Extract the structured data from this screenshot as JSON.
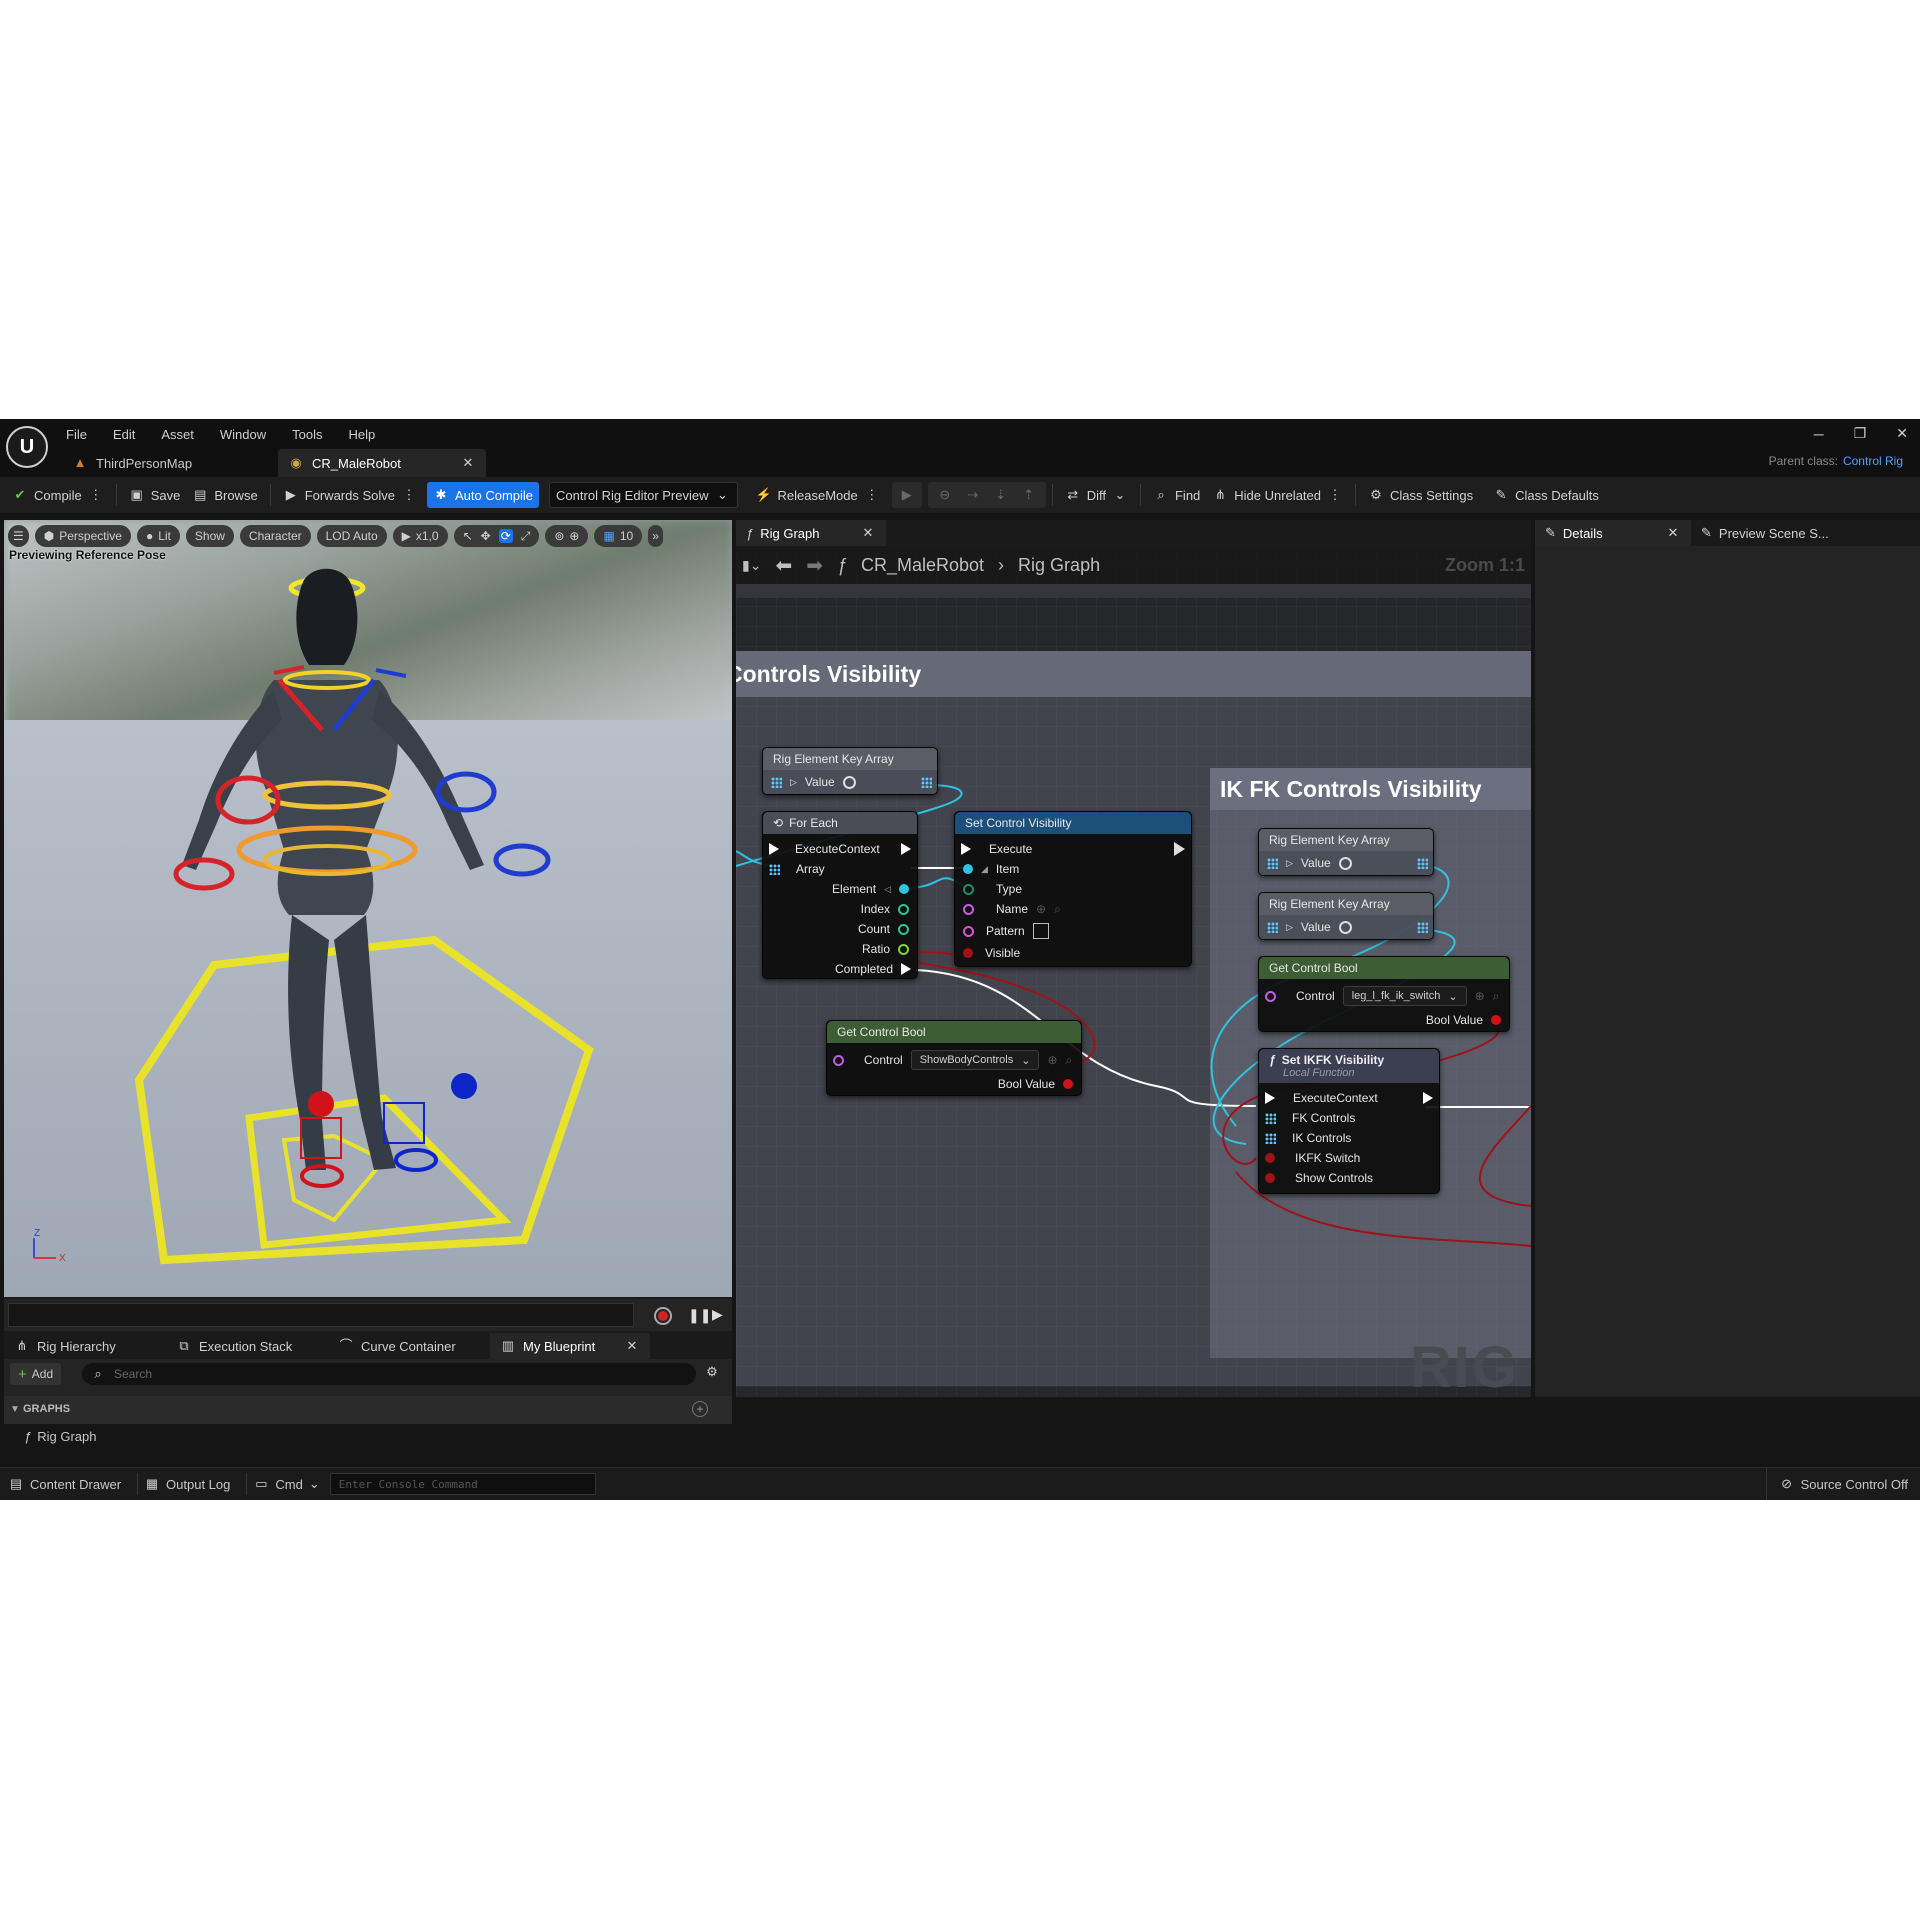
{
  "window": {
    "menu": [
      "File",
      "Edit",
      "Asset",
      "Window",
      "Tools",
      "Help"
    ],
    "tabs": [
      {
        "label": "ThirdPersonMap"
      },
      {
        "label": "CR_MaleRobot"
      }
    ],
    "parent_class_label": "Parent class:",
    "parent_class_value": "Control Rig",
    "controls": {
      "minimize": "─",
      "restore": "❐",
      "close": "✕"
    }
  },
  "toolbar": {
    "compile": "Compile",
    "save": "Save",
    "browse": "Browse",
    "forwards_solve": "Forwards Solve",
    "auto_compile": "Auto Compile",
    "preview_select": "Control Rig Editor Preview",
    "release_mode": "ReleaseMode",
    "diff": "Diff",
    "find": "Find",
    "hide_unrelated": "Hide Unrelated",
    "class_settings": "Class Settings",
    "class_defaults": "Class Defaults"
  },
  "viewport": {
    "buttons": {
      "perspective": "Perspective",
      "lit": "Lit",
      "show": "Show",
      "character": "Character",
      "lod": "LOD Auto",
      "speed": "x1,0",
      "grid": "10"
    },
    "overlay": "Previewing Reference Pose",
    "axis_z": "Z",
    "axis_x": "X"
  },
  "bottom_panel": {
    "tabs": [
      "Rig Hierarchy",
      "Execution Stack",
      "Curve Container",
      "My Blueprint"
    ],
    "add": "Add",
    "search_placeholder": "Search",
    "section": "GRAPHS",
    "graph_item": "Rig Graph"
  },
  "graph": {
    "tab": "Rig Graph",
    "breadcrumb_asset": "CR_MaleRobot",
    "breadcrumb_graph": "Rig Graph",
    "zoom": "Zoom 1:1",
    "watermark": "RIG",
    "comment_1": "Controls Visibility",
    "comment_2": "IK FK Controls Visibility",
    "nodes": {
      "rig_key_array": {
        "title": "Rig Element Key Array",
        "value": "Value"
      },
      "for_each": {
        "title": "For Each",
        "pins": [
          "ExecuteContext",
          "Array",
          "Element",
          "Index",
          "Count",
          "Ratio",
          "Completed"
        ]
      },
      "set_visibility": {
        "title": "Set Control Visibility",
        "pins": [
          "Execute",
          "Item",
          "Type",
          "Name",
          "Pattern",
          "Visible"
        ]
      },
      "get_bool_1": {
        "title": "Get Control Bool",
        "control_label": "Control",
        "control_value": "ShowBodyControls",
        "out": "Bool Value"
      },
      "ik_key_array_1": {
        "title": "Rig Element Key Array",
        "value": "Value"
      },
      "ik_key_array_2": {
        "title": "Rig Element Key Array",
        "value": "Value"
      },
      "get_bool_2": {
        "title": "Get Control Bool",
        "control_label": "Control",
        "control_value": "leg_l_fk_ik_switch",
        "out": "Bool Value"
      },
      "set_ikfk": {
        "title": "Set IKFK Visibility",
        "subtitle": "Local Function",
        "pins": [
          "ExecuteContext",
          "FK Controls",
          "IK Controls",
          "IKFK Switch",
          "Show Controls"
        ]
      }
    }
  },
  "right_panel": {
    "details": "Details",
    "preview": "Preview Scene S..."
  },
  "statusbar": {
    "content_drawer": "Content Drawer",
    "output_log": "Output Log",
    "cmd": "Cmd",
    "console_placeholder": "Enter Console Command",
    "source_control": "Source Control Off"
  },
  "colors": {
    "accent": "#1a73e8",
    "exec_wire": "#ffffff",
    "array_wire": "#2fc3df",
    "bool_wire": "#a0121a",
    "node_header_blue": "#1c4f7a",
    "node_header_green": "#3d5d34"
  }
}
